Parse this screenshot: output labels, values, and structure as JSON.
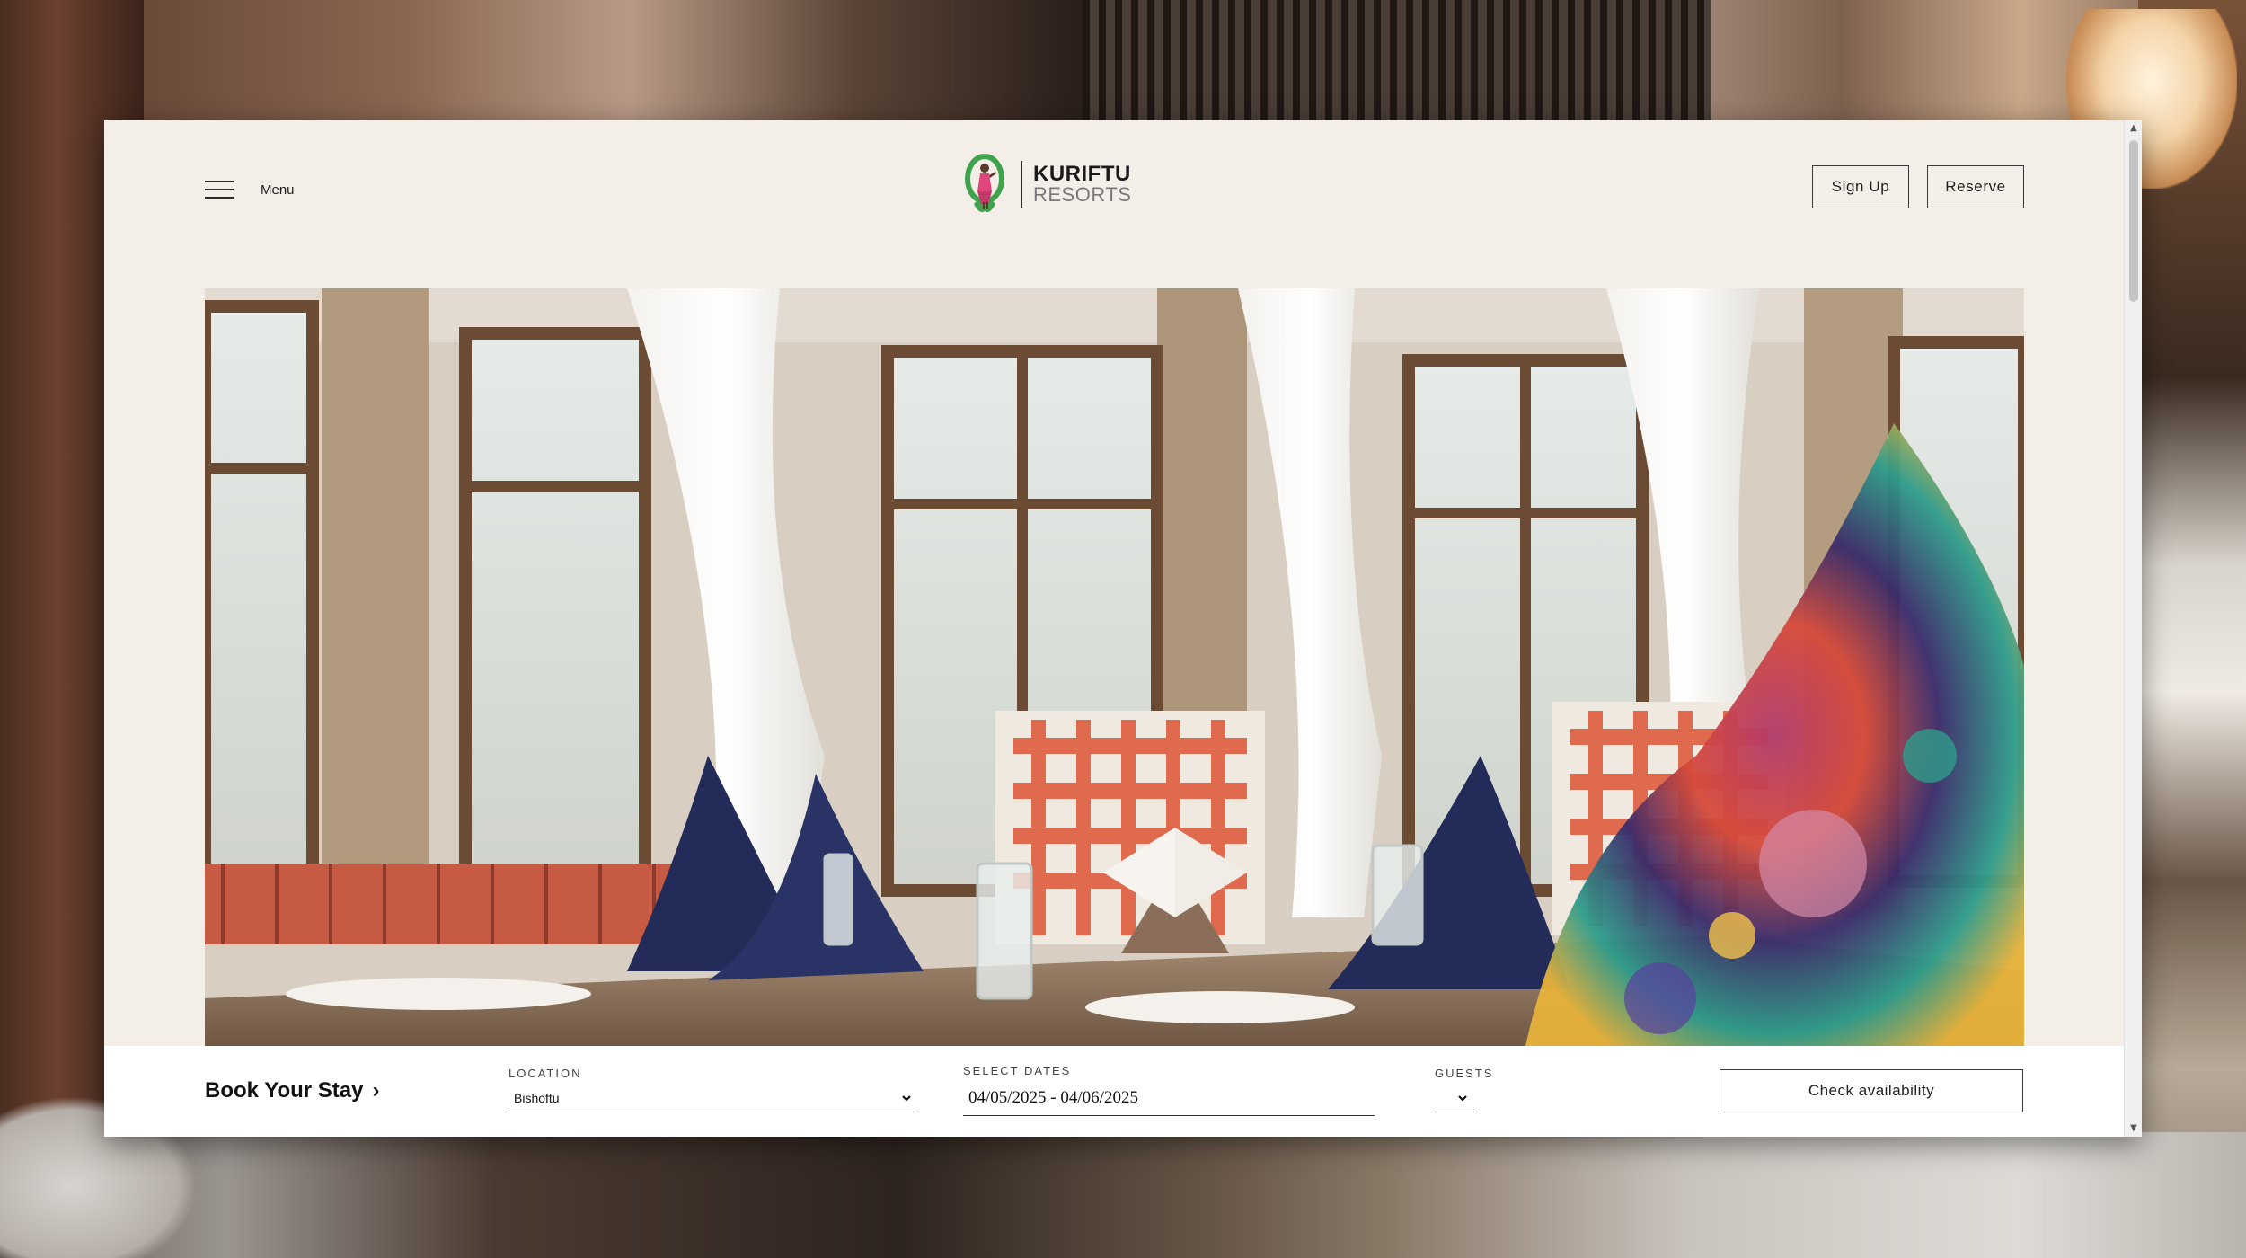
{
  "header": {
    "menu_label": "Menu",
    "logo_title": "KURIFTU",
    "logo_subtitle": "RESORTS",
    "signup_label": "Sign Up",
    "reserve_label": "Reserve"
  },
  "booking": {
    "title": "Book Your Stay",
    "title_chevron": "›",
    "location_label": "LOCATION",
    "location_value": "Bishoftu",
    "dates_label": "SELECT DATES",
    "dates_value": "04/05/2025 - 04/06/2025",
    "guests_label": "GUESTS",
    "guests_value": "",
    "check_label": "Check availability"
  },
  "scrollbar": {
    "up_arrow": "▲",
    "down_arrow": "▼"
  },
  "colors": {
    "page_bg": "#f3eee8",
    "booking_bg": "#ffffff",
    "logo_green": "#3fa34d",
    "logo_pink": "#e0467c",
    "chair_orange": "#e06a4e",
    "napkin_navy": "#232b58"
  },
  "icons": {
    "menu": "hamburger-icon",
    "logo": "kuriftu-logo-icon",
    "title_arrow": "chevron-right-icon",
    "select": "chevron-down-icon"
  }
}
